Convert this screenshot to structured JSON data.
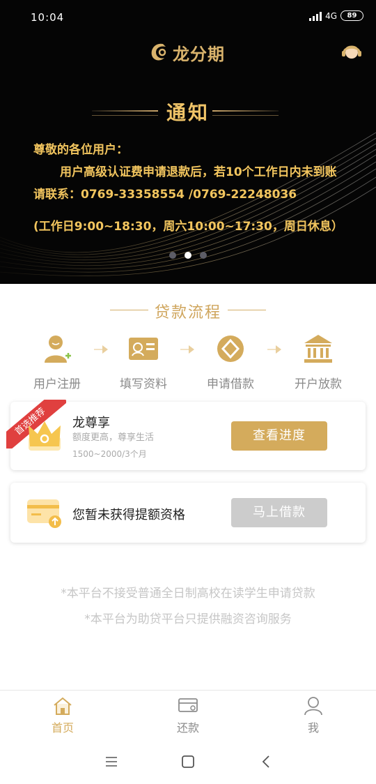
{
  "status_bar": {
    "time": "10:04",
    "network": "4G",
    "battery": "89"
  },
  "header": {
    "app_name": "龙分期"
  },
  "banner": {
    "notice_title": "通知",
    "line1": "尊敬的各位用户：",
    "line2": "用户高级认证费申请退款后，若10个工作日内未到账",
    "line3": "请联系：0769-33358554 /0769-22248036",
    "line4": "(工作日9:00~18:30，周六10:00~17:30，周日休息）",
    "slides_total": 3,
    "active_slide": 2
  },
  "loan_process": {
    "title": "贷款流程",
    "steps": [
      {
        "label": "用户注册",
        "icon": "user-add-icon"
      },
      {
        "label": "填写资料",
        "icon": "id-card-icon"
      },
      {
        "label": "申请借款",
        "icon": "coin-icon"
      },
      {
        "label": "开户放款",
        "icon": "bank-icon"
      }
    ]
  },
  "product_card": {
    "badge": "首选推荐",
    "title": "龙尊享",
    "subtitle": "额度更高，尊享生活",
    "range": "1500~2000/3个月",
    "button": "查看进度"
  },
  "quota_card": {
    "text": "您暂未获得提额资格",
    "button": "马上借款"
  },
  "disclaimers": {
    "line1": "*本平台不接受普通全日制高校在读学生申请贷款",
    "line2": "*本平台为助贷平台只提供融资咨询服务"
  },
  "tabbar": {
    "items": [
      {
        "label": "首页",
        "icon": "home-icon",
        "active": true
      },
      {
        "label": "还款",
        "icon": "repay-card-icon",
        "active": false
      },
      {
        "label": "我",
        "icon": "profile-icon",
        "active": false
      }
    ]
  },
  "colors": {
    "gold": "#d4ab5c",
    "notice_gold": "#f2c55e",
    "banner_bg": "#050505",
    "ribbon_red": "#e0403f"
  }
}
